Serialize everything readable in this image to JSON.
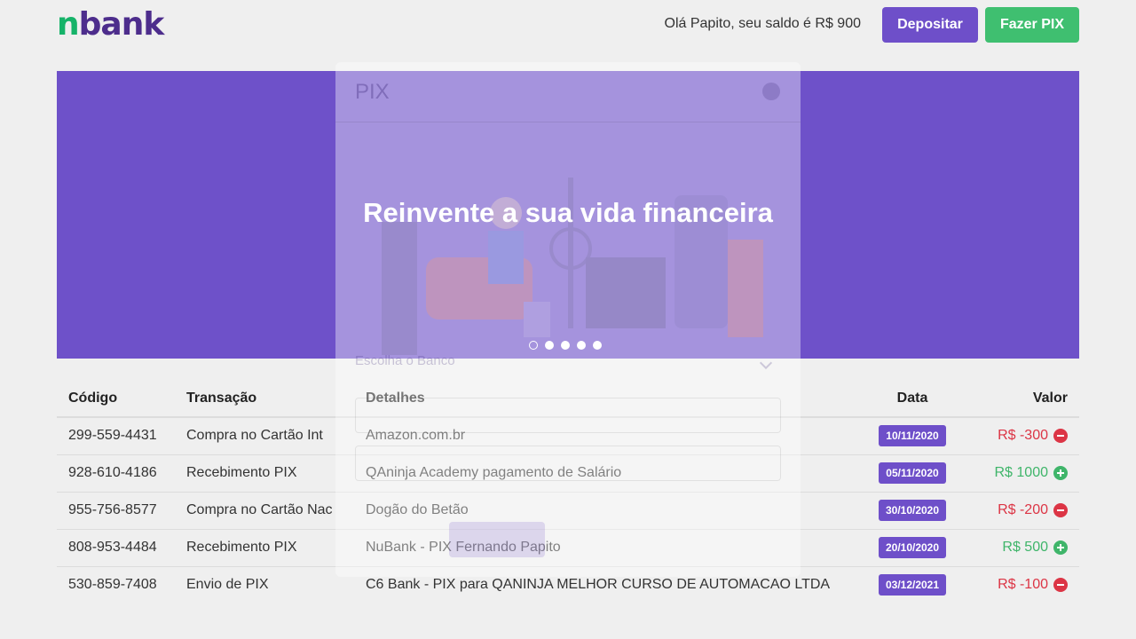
{
  "header": {
    "logo_n": "n",
    "logo_rest": "bank",
    "greeting": "Olá Papito, seu saldo é R$ 900",
    "deposit_label": "Depositar",
    "pix_label": "Fazer PIX"
  },
  "hero": {
    "title": "Reinvente a sua vida financeira",
    "slides": 5,
    "active_slide": 1
  },
  "modal": {
    "title": "PIX",
    "select_placeholder": "Escolha o Banco"
  },
  "table": {
    "headers": {
      "code": "Código",
      "transaction": "Transação",
      "details": "Detalhes",
      "date": "Data",
      "value": "Valor"
    },
    "rows": [
      {
        "code": "299-559-4431",
        "transaction": "Compra no Cartão Int",
        "details": "Amazon.com.br",
        "date": "10/11/2020",
        "value": "R$ -300",
        "type": "negative"
      },
      {
        "code": "928-610-4186",
        "transaction": "Recebimento PIX",
        "details": "QAninja Academy pagamento de Salário",
        "date": "05/11/2020",
        "value": "R$ 1000",
        "type": "positive"
      },
      {
        "code": "955-756-8577",
        "transaction": "Compra no Cartão Nac",
        "details": "Dogão do Betão",
        "date": "30/10/2020",
        "value": "R$ -200",
        "type": "negative"
      },
      {
        "code": "808-953-4484",
        "transaction": "Recebimento PIX",
        "details": "NuBank - PIX Fernando Papito",
        "date": "20/10/2020",
        "value": "R$ 500",
        "type": "positive"
      },
      {
        "code": "530-859-7408",
        "transaction": "Envio de PIX",
        "details": "C6 Bank - PIX para QANINJA MELHOR CURSO DE AUTOMACAO LTDA",
        "date": "03/12/2021",
        "value": "R$ -100",
        "type": "negative"
      }
    ]
  },
  "colors": {
    "brand_purple": "#6e4fc9",
    "brand_green": "#16b369",
    "negative": "#dc3545",
    "positive": "#3fb56a"
  },
  "icons": {
    "negative": "minus-circle-icon",
    "positive": "plus-circle-icon"
  }
}
